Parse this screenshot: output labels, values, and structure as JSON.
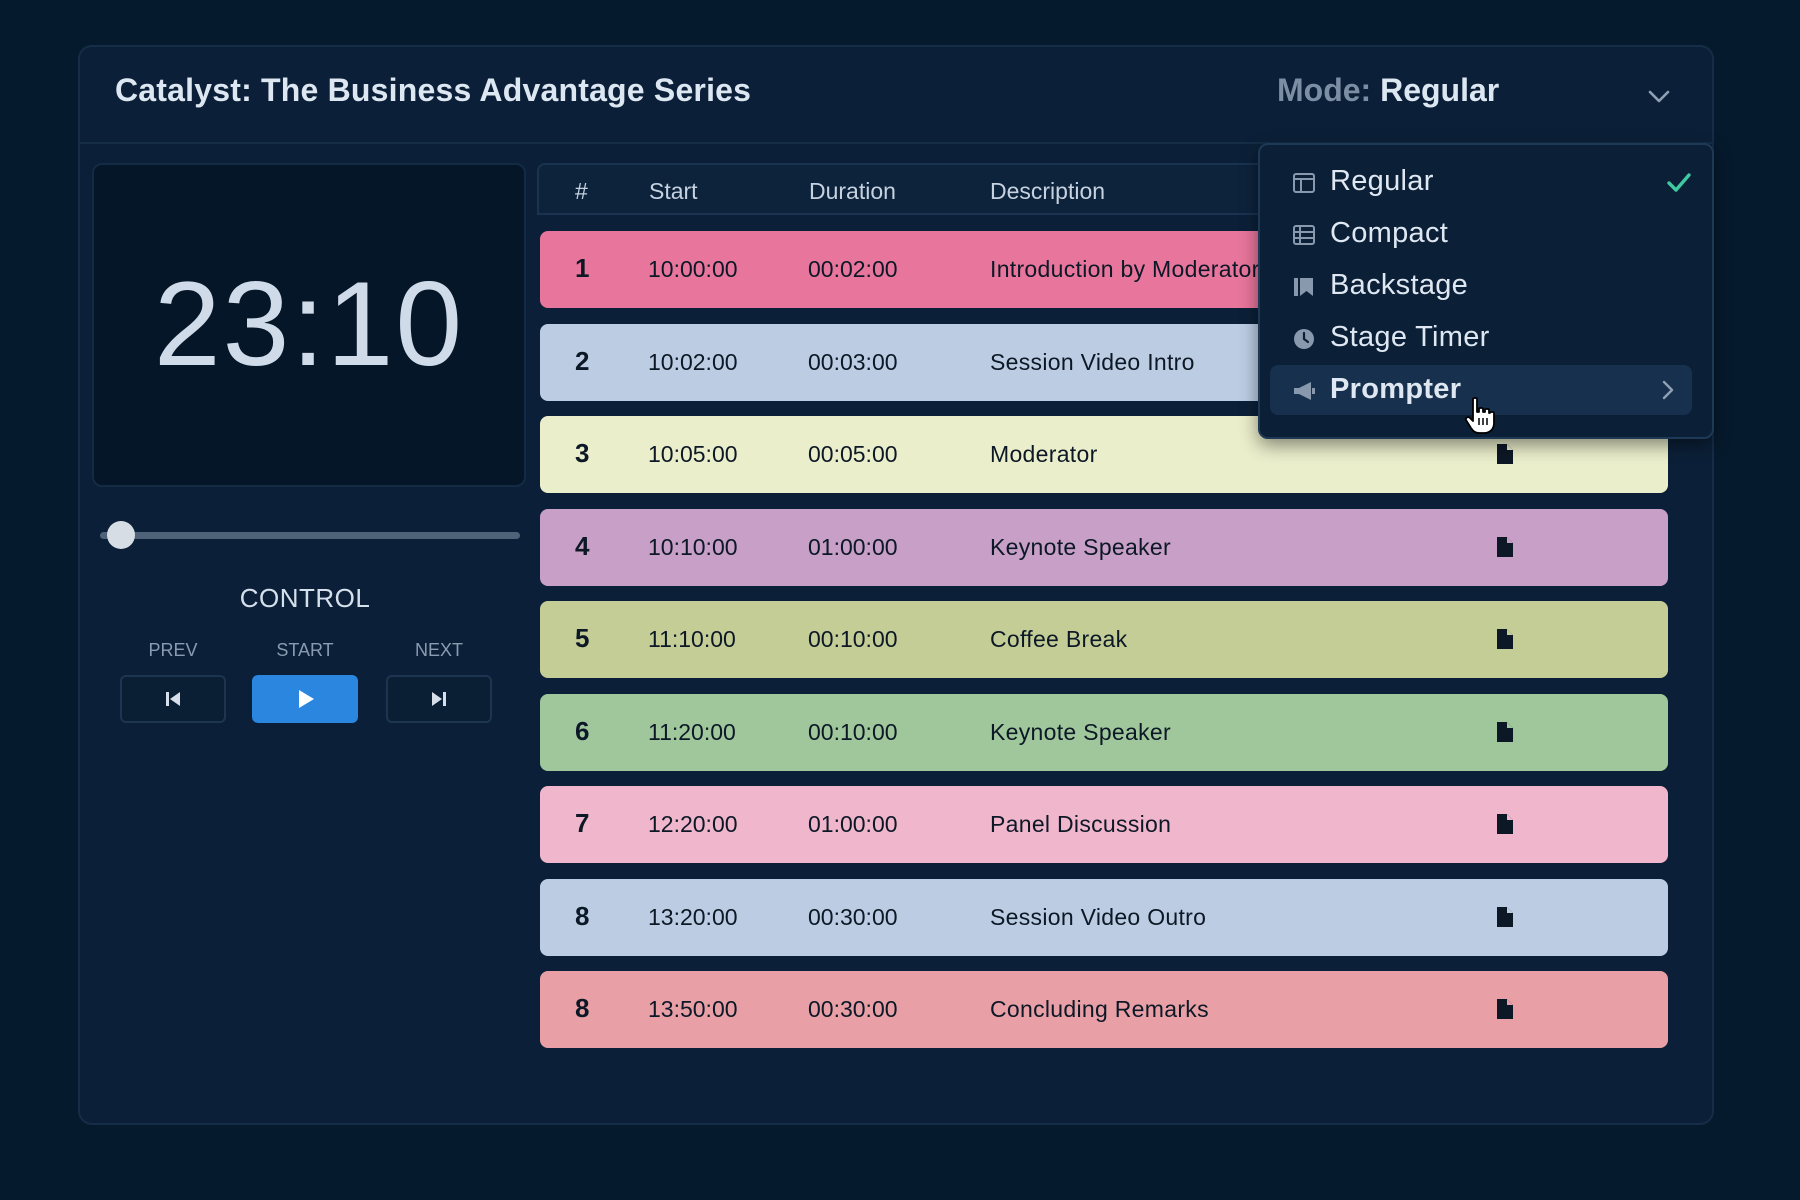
{
  "header": {
    "title": "Catalyst: The Business Advantage Series",
    "mode_label": "Mode:",
    "mode_value": "Regular"
  },
  "clock": {
    "time": "23:10"
  },
  "slider": {
    "position_fraction": 0.05
  },
  "control": {
    "title": "CONTROL",
    "prev_label": "PREV",
    "start_label": "START",
    "next_label": "NEXT"
  },
  "table": {
    "columns": [
      "#",
      "Start",
      "Duration",
      "Description"
    ],
    "rows": [
      {
        "num": "1",
        "start": "10:00:00",
        "duration": "00:02:00",
        "description": "Introduction by Moderator",
        "color": "#e8769c"
      },
      {
        "num": "2",
        "start": "10:02:00",
        "duration": "00:03:00",
        "description": "Session Video Intro",
        "color": "#bccde3"
      },
      {
        "num": "3",
        "start": "10:05:00",
        "duration": "00:05:00",
        "description": "Moderator",
        "color": "#eaeecb"
      },
      {
        "num": "4",
        "start": "10:10:00",
        "duration": "01:00:00",
        "description": "Keynote Speaker",
        "color": "#c79fc7"
      },
      {
        "num": "5",
        "start": "11:10:00",
        "duration": "00:10:00",
        "description": "Coffee Break",
        "color": "#c4cd96"
      },
      {
        "num": "6",
        "start": "11:20:00",
        "duration": "00:10:00",
        "description": "Keynote Speaker",
        "color": "#a0c79c"
      },
      {
        "num": "7",
        "start": "12:20:00",
        "duration": "01:00:00",
        "description": "Panel Discussion",
        "color": "#f0b6cc"
      },
      {
        "num": "8",
        "start": "13:20:00",
        "duration": "00:30:00",
        "description": "Session Video Outro",
        "color": "#bccde3"
      },
      {
        "num": "8",
        "start": "13:50:00",
        "duration": "00:30:00",
        "description": "Concluding Remarks",
        "color": "#e8a0a6"
      }
    ]
  },
  "mode_menu": {
    "items": [
      {
        "label": "Regular",
        "icon": "layout-icon",
        "selected": true
      },
      {
        "label": "Compact",
        "icon": "table-icon",
        "selected": false
      },
      {
        "label": "Backstage",
        "icon": "bookmark-icon",
        "selected": false
      },
      {
        "label": "Stage Timer",
        "icon": "clock-icon",
        "selected": false
      },
      {
        "label": "Prompter",
        "icon": "megaphone-icon",
        "selected": false,
        "highlighted": true,
        "has_submenu": true
      }
    ]
  },
  "colors": {
    "background": "#061a2d",
    "panel": "#0b2038",
    "accent_blue": "#2b86e0",
    "check_green": "#3fc9a0"
  }
}
